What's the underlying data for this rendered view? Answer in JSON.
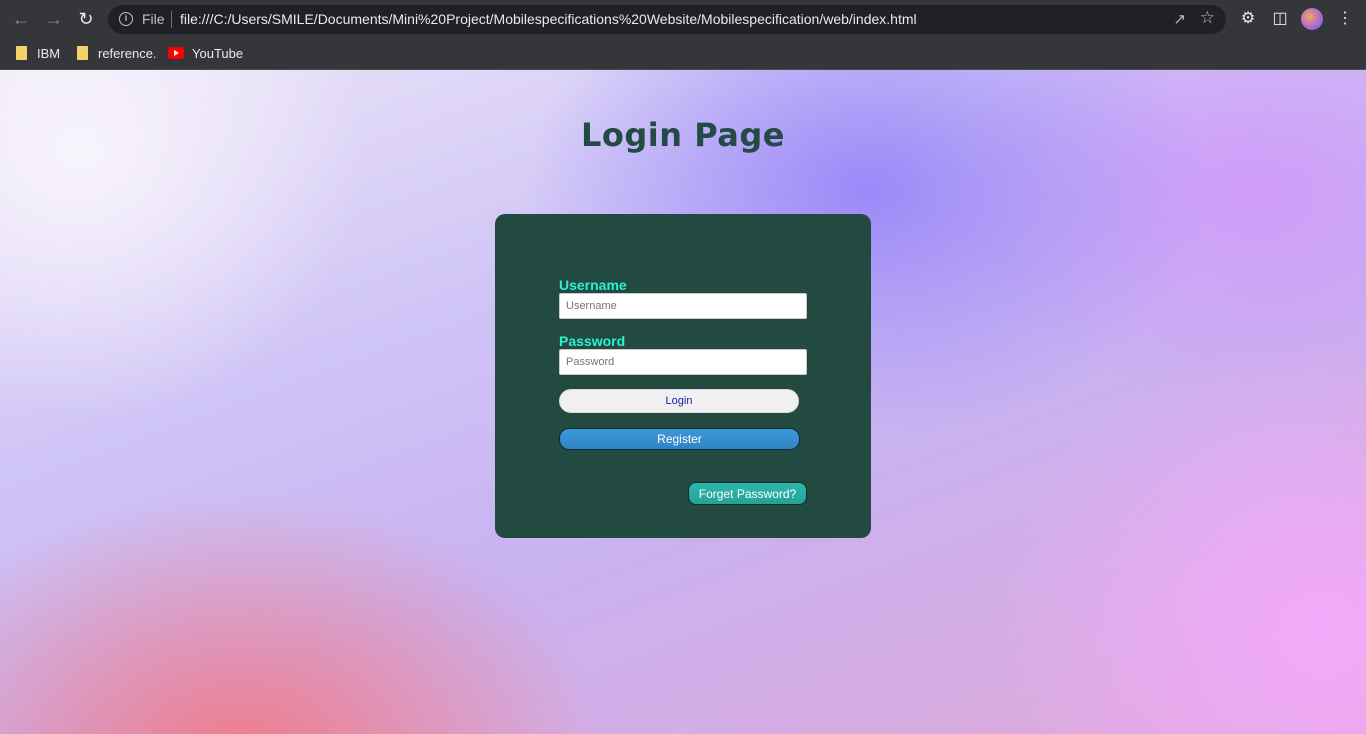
{
  "browser": {
    "address_scheme_label": "File",
    "url": "file:///C:/Users/SMILE/Documents/Mini%20Project/Mobilespecifications%20Website/Mobilespecification/web/index.html",
    "bookmarks": [
      {
        "label": "IBM",
        "icon": "folder-icon"
      },
      {
        "label": "reference.",
        "icon": "folder-icon"
      },
      {
        "label": "YouTube",
        "icon": "youtube-icon"
      }
    ]
  },
  "page": {
    "title": "Login Page",
    "username_label": "Username",
    "username_placeholder": "Username",
    "password_label": "Password",
    "password_placeholder": "Password",
    "login_label": "Login",
    "register_label": "Register",
    "forget_label": "Forget Password?"
  },
  "colors": {
    "card_background": "#234a40",
    "label_color": "#27f2d2",
    "title_color": "#234a44",
    "register_button": "#2f84c4",
    "forget_button": "#24a397"
  }
}
